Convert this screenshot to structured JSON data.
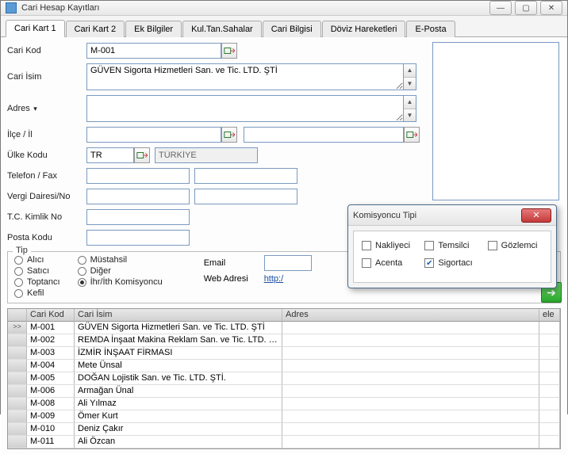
{
  "window": {
    "title": "Cari Hesap Kayıtları"
  },
  "tabs": [
    {
      "label": "Cari Kart 1",
      "active": true
    },
    {
      "label": "Cari Kart 2"
    },
    {
      "label": "Ek Bilgiler"
    },
    {
      "label": "Kul.Tan.Sahalar"
    },
    {
      "label": "Cari Bilgisi"
    },
    {
      "label": "Döviz Hareketleri"
    },
    {
      "label": "E-Posta"
    }
  ],
  "labels": {
    "cariKod": "Cari Kod",
    "cariIsim": "Cari İsim",
    "adres": "Adres",
    "ilceIl": "İlçe / İl",
    "ulkeKodu": "Ülke Kodu",
    "telefonFax": "Telefon / Fax",
    "vergiDairesiNo": "Vergi Dairesi/No",
    "tcKimlik": "T.C. Kimlik No",
    "postaKodu": "Posta Kodu",
    "tip": "Tip",
    "email": "Email",
    "webAdresi": "Web Adresi",
    "http": "http:/"
  },
  "values": {
    "cariKod": "M-001",
    "cariIsim": "GÜVEN Sigorta Hizmetleri San. ve Tic. LTD. ŞTİ",
    "ulkeKodu": "TR",
    "ulkeAdi": "TÜRKİYE"
  },
  "tipOptions": {
    "col1": [
      "Alıcı",
      "Satıcı",
      "Toptancı",
      "Kefil"
    ],
    "col2": [
      "Müstahsil",
      "Diğer",
      "İhr/İth Komisyoncu"
    ],
    "selected": "İhr/İth Komisyoncu"
  },
  "grid": {
    "headers": {
      "kod": "Cari Kod",
      "isim": "Cari İsim",
      "adres": "Adres",
      "ele": "ele"
    },
    "rows": [
      {
        "kod": "M-001",
        "isim": "GÜVEN Sigorta Hizmetleri San. ve Tic. LTD. ŞTİ",
        "mark": true
      },
      {
        "kod": "M-002",
        "isim": "REMDA İnşaat Makina Reklam San. ve Tic. LTD. ŞTİ."
      },
      {
        "kod": "M-003",
        "isim": "İZMİR İNŞAAT FİRMASI"
      },
      {
        "kod": "M-004",
        "isim": "Mete Ünsal"
      },
      {
        "kod": "M-005",
        "isim": "DOĞAN Lojistik San. ve Tic. LTD. ŞTİ."
      },
      {
        "kod": "M-006",
        "isim": "Armağan Ünal"
      },
      {
        "kod": "M-008",
        "isim": "Ali Yılmaz"
      },
      {
        "kod": "M-009",
        "isim": "Ömer Kurt"
      },
      {
        "kod": "M-010",
        "isim": "Deniz Çakır"
      },
      {
        "kod": "M-011",
        "isim": "Ali Özcan"
      }
    ]
  },
  "popup": {
    "title": "Komisyoncu Tipi",
    "options": [
      {
        "label": "Nakliyeci",
        "checked": false
      },
      {
        "label": "Temsilci",
        "checked": false
      },
      {
        "label": "Gözlemci",
        "checked": false
      },
      {
        "label": "Acenta",
        "checked": false
      },
      {
        "label": "Sigortacı",
        "checked": true
      }
    ]
  }
}
